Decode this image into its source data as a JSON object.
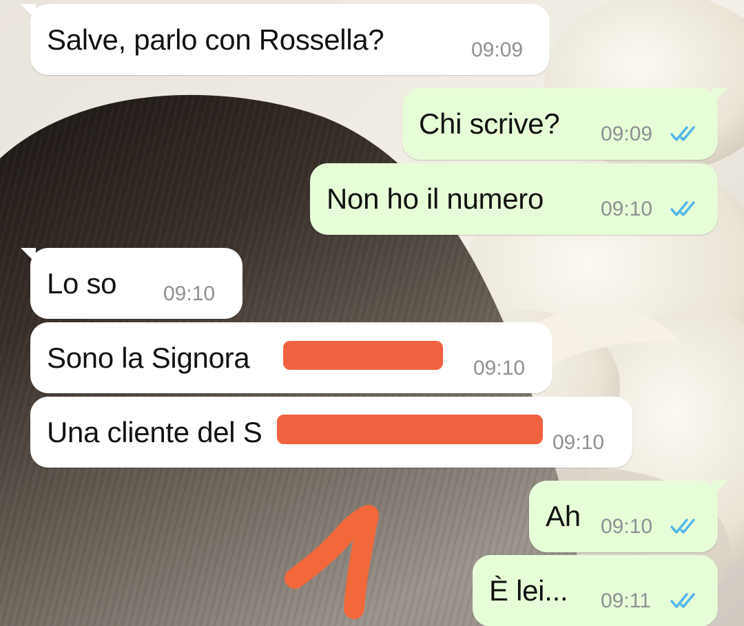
{
  "colors": {
    "incoming_bubble": "#ffffff",
    "outgoing_bubble": "#e7fdd8",
    "timestamp": "#8e9094",
    "read_ticks": "#4fb6ec",
    "redaction": "#f2613f",
    "annotation_arrow": "#f2683a"
  },
  "messages": [
    {
      "direction": "incoming",
      "text": "Salve, parlo con Rossella?",
      "time": "09:09"
    },
    {
      "direction": "outgoing",
      "text": "Chi scrive?",
      "time": "09:09",
      "status_icon": "double-check-read-icon"
    },
    {
      "direction": "outgoing",
      "text": "Non ho il numero",
      "time": "09:10",
      "status_icon": "double-check-read-icon"
    },
    {
      "direction": "incoming",
      "text": "Lo so",
      "time": "09:10"
    },
    {
      "direction": "incoming",
      "text": "Sono la Signora",
      "time": "09:10",
      "redacted": true
    },
    {
      "direction": "incoming",
      "text": "Una cliente del S",
      "time": "09:10",
      "redacted": true
    },
    {
      "direction": "outgoing",
      "text": "Ah",
      "time": "09:10",
      "status_icon": "double-check-read-icon"
    },
    {
      "direction": "outgoing",
      "text": "È lei...",
      "time": "09:11",
      "status_icon": "double-check-read-icon"
    }
  ]
}
